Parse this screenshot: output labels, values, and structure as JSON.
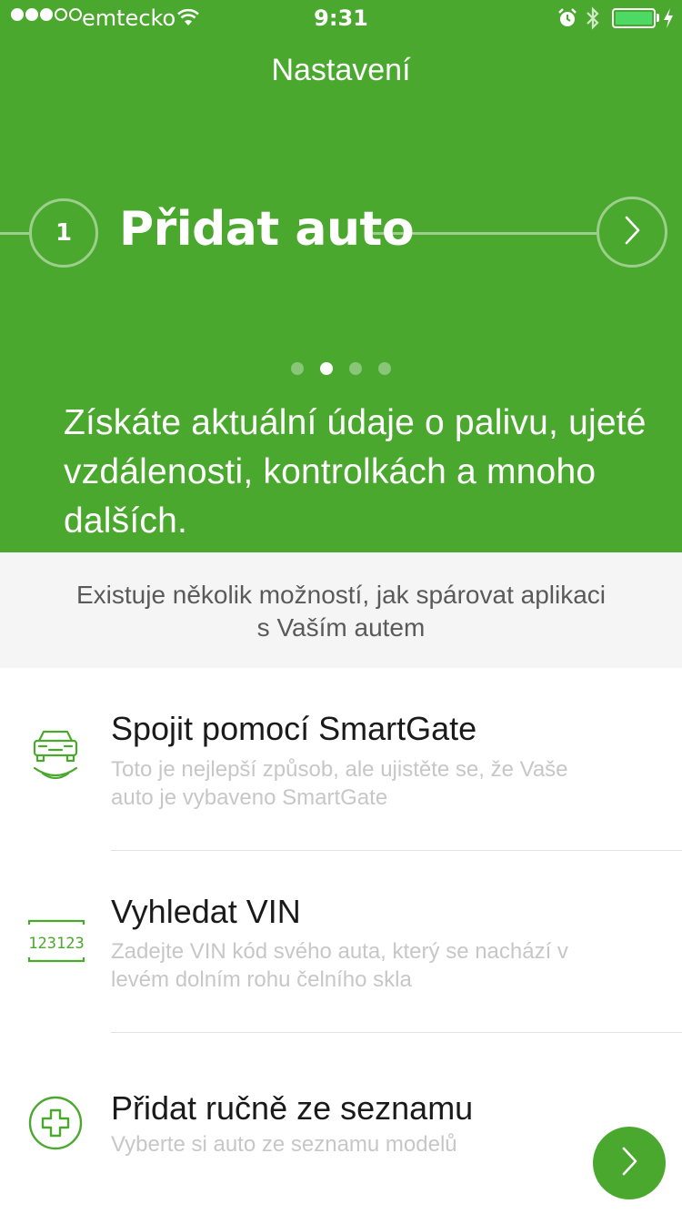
{
  "status_bar": {
    "carrier": "emtecko",
    "time": "9:31",
    "battery_color": "#4cd964"
  },
  "nav": {
    "title": "Nastavení"
  },
  "step": {
    "number": "1",
    "title": "Přidat auto",
    "next_icon": "chevron-right-icon"
  },
  "pager": {
    "total": 4,
    "active_index": 1
  },
  "description": "Získáte aktuální údaje o palivu, ujeté vzdálenosti, kontrolkách a mnoho dalších.",
  "info": {
    "line1": "Existuje několik možností, jak spárovat aplikaci",
    "line2": "s Vaším autem"
  },
  "options": [
    {
      "title": "Spojit pomocí SmartGate",
      "subtitle_line1": "Toto je nejlepší způsob, ale ujistěte se, že Vaše",
      "subtitle_line2": "auto je vybaveno SmartGate",
      "icon": "smartgate-car-icon"
    },
    {
      "title": "Vyhledat VIN",
      "subtitle_line1": "Zadejte VIN kód svého auta, který se nachází v",
      "subtitle_line2": "levém dolním rohu čelního skla",
      "icon": "vin-code-icon",
      "icon_text": "123123"
    },
    {
      "title": "Přidat ručně ze seznamu",
      "subtitle_line1": "Vyberte si auto ze seznamu modelů",
      "icon": "add-plus-icon"
    }
  ],
  "colors": {
    "brand_green": "#4ba82e",
    "info_background": "#f5f5f5",
    "subtitle_gray": "#c7c7c7"
  }
}
